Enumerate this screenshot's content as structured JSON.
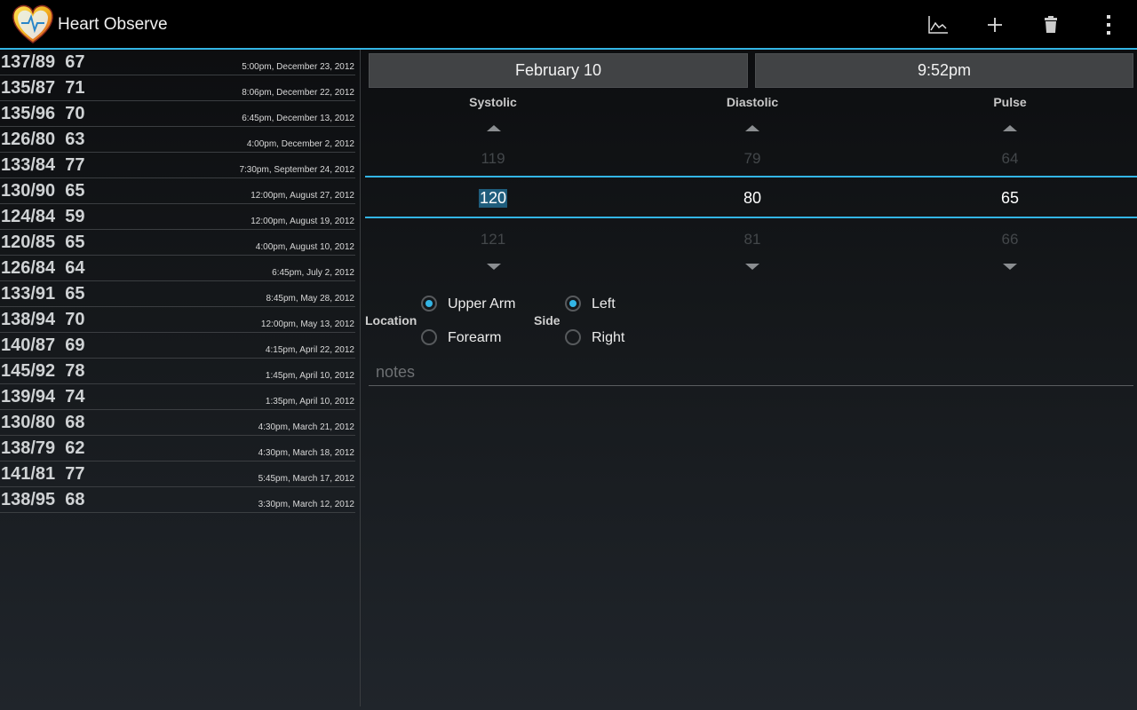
{
  "app": {
    "title": "Heart Observe",
    "logo_icon": "heart-logo-icon"
  },
  "actionbar": {
    "actions": [
      {
        "name": "graph-button",
        "icon": "chart-line-icon"
      },
      {
        "name": "add-button",
        "icon": "plus-icon"
      },
      {
        "name": "delete-button",
        "icon": "trash-icon"
      },
      {
        "name": "overflow-menu-button",
        "icon": "more-vert-icon"
      }
    ]
  },
  "readings": [
    {
      "reading": "137/89  67",
      "when": "5:00pm, December 23, 2012"
    },
    {
      "reading": "135/87  71",
      "when": "8:06pm, December 22, 2012"
    },
    {
      "reading": "135/96  70",
      "when": "6:45pm, December 13, 2012"
    },
    {
      "reading": "126/80  63",
      "when": "4:00pm, December 2, 2012"
    },
    {
      "reading": "133/84  77",
      "when": "7:30pm, September 24, 2012"
    },
    {
      "reading": "130/90  65",
      "when": "12:00pm, August 27, 2012"
    },
    {
      "reading": "124/84  59",
      "when": "12:00pm, August 19, 2012"
    },
    {
      "reading": "120/85  65",
      "when": "4:00pm, August 10, 2012"
    },
    {
      "reading": "126/84  64",
      "when": "6:45pm, July 2, 2012"
    },
    {
      "reading": "133/91  65",
      "when": "8:45pm, May 28, 2012"
    },
    {
      "reading": "138/94  70",
      "when": "12:00pm, May 13, 2012"
    },
    {
      "reading": "140/87  69",
      "when": "4:15pm, April 22, 2012"
    },
    {
      "reading": "145/92  78",
      "when": "1:45pm, April 10, 2012"
    },
    {
      "reading": "139/94  74",
      "when": "1:35pm, April 10, 2012"
    },
    {
      "reading": "130/80  68",
      "when": "4:30pm, March 21, 2012"
    },
    {
      "reading": "138/79  62",
      "when": "4:30pm, March 18, 2012"
    },
    {
      "reading": "141/81  77",
      "when": "5:45pm, March 17, 2012"
    },
    {
      "reading": "138/95  68",
      "when": "3:30pm, March 12, 2012"
    }
  ],
  "form": {
    "date": "February 10",
    "time": "9:52pm",
    "systolic": {
      "label": "Systolic",
      "prev": "119",
      "current": "120",
      "next": "121"
    },
    "diastolic": {
      "label": "Diastolic",
      "prev": "79",
      "current": "80",
      "next": "81"
    },
    "pulse": {
      "label": "Pulse",
      "prev": "64",
      "current": "65",
      "next": "66"
    },
    "location": {
      "label": "Location",
      "options": [
        "Upper Arm",
        "Forearm"
      ],
      "selected": "Upper Arm"
    },
    "side": {
      "label": "Side",
      "options": [
        "Left",
        "Right"
      ],
      "selected": "Left"
    },
    "notes_placeholder": "notes",
    "notes_value": ""
  },
  "colors": {
    "accent": "#33b5e5",
    "actionbar": "#000000",
    "button": "#414345"
  }
}
